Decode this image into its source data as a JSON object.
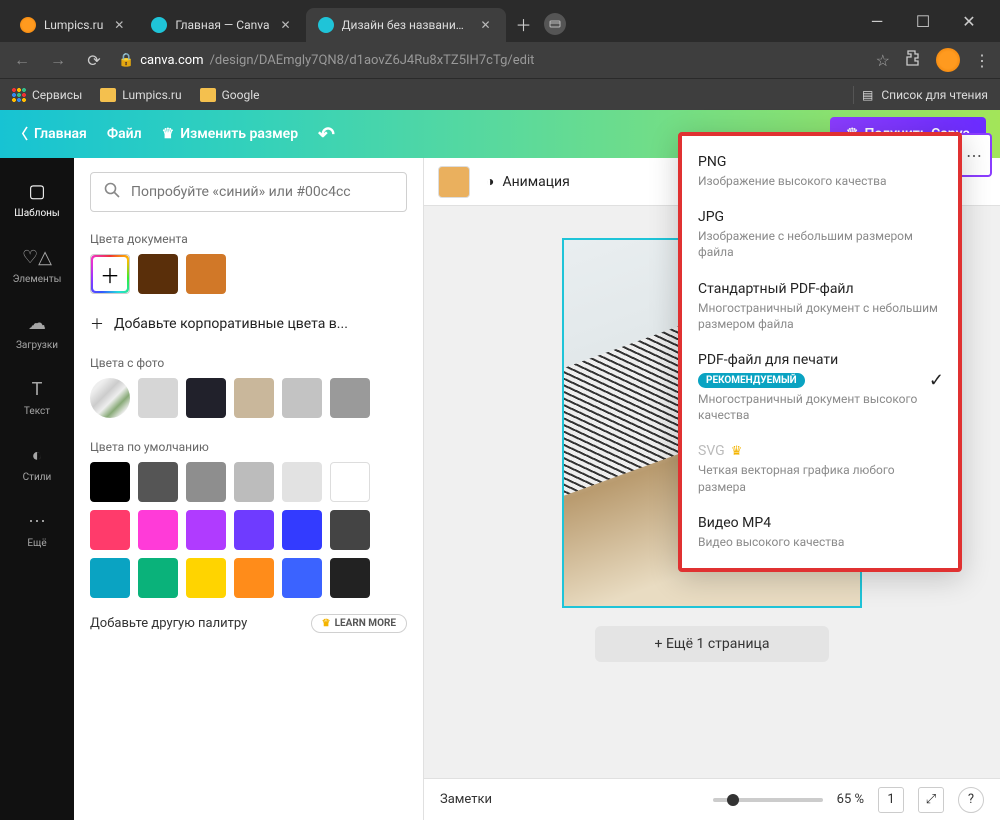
{
  "browser": {
    "tabs": [
      {
        "title": "Lumpics.ru",
        "favicon": "#ff8c1a"
      },
      {
        "title": "Главная — Canva",
        "favicon": "#1fc4d8"
      },
      {
        "title": "Дизайн без названия — Invitat",
        "favicon": "#1fc4d8",
        "active": true
      }
    ],
    "url_domain": "canva.com",
    "url_path": "/design/DAEmgly7QN8/d1aovZ6J4Ru8xTZ5IH7cTg/edit",
    "bookmarks": {
      "apps": "Сервисы",
      "b1": "Lumpics.ru",
      "b2": "Google",
      "reading_list": "Список для чтения"
    }
  },
  "header": {
    "home": "Главная",
    "file": "Файл",
    "resize": "Изменить размер",
    "try": "Получить Canva"
  },
  "rail": {
    "templates": "Шаблоны",
    "elements": "Элементы",
    "uploads": "Загрузки",
    "text": "Текст",
    "styles": "Стили",
    "more": "Ещё"
  },
  "panel": {
    "search_placeholder": "Попробуйте «синий» или #00c4cc",
    "doc_colors": "Цвета документа",
    "add_brand": "Добавьте корпоративные цвета в...",
    "photo_colors": "Цвета с фото",
    "default_colors": "Цвета по умолчанию",
    "another_palette": "Добавьте другую палитру",
    "learn_more": "LEARN MORE",
    "doc_swatches": [
      "#5a2f0a",
      "#d17828"
    ],
    "photo_swatches": [
      "#d6d6d6",
      "#21212b",
      "#c9b79b",
      "#c3c3c3",
      "#9a9a9a"
    ],
    "default_swatches": [
      "#000000",
      "#555555",
      "#8e8e8e",
      "#bcbcbc",
      "#e2e2e2",
      "#ffffff",
      "#ff3b6b",
      "#ff3bd8",
      "#b03bff",
      "#6f3bff",
      "#333bff",
      "#444444",
      "#0aa3c2",
      "#0ab27a",
      "#ffd400",
      "#ff8c1a",
      "#3b63ff",
      "#222222"
    ]
  },
  "canvas": {
    "color": "#eab05e",
    "animation": "Анимация",
    "add_page": "+ Ещё 1 страница",
    "notes": "Заметки",
    "zoom": "65 %",
    "page_num": "1"
  },
  "download": {
    "items": [
      {
        "title": "PNG",
        "desc": "Изображение высокого качества"
      },
      {
        "title": "JPG",
        "desc": "Изображение с небольшим размером файла"
      },
      {
        "title": "Стандартный PDF-файл",
        "desc": "Многостраничный документ с небольшим размером файла"
      },
      {
        "title": "PDF-файл для печати",
        "desc": "Многостраничный документ высокого качества",
        "badge": "РЕКОМЕНДУЕМЫЙ",
        "checked": true
      },
      {
        "title": "SVG",
        "desc": "Четкая векторная графика любого размера",
        "premium": true,
        "disabled": true
      },
      {
        "title": "Видео MP4",
        "desc": "Видео высокого качества"
      }
    ]
  }
}
